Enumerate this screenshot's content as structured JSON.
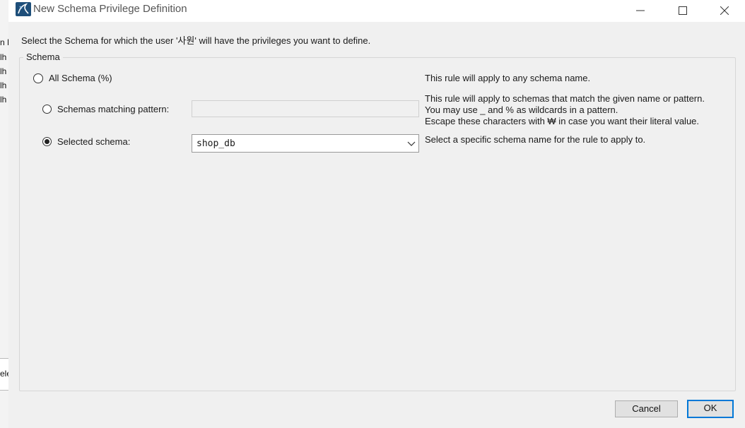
{
  "background_app": {
    "lines": [
      "n H",
      "lh",
      "lh",
      "lh",
      "lh"
    ],
    "bottom_text": "ele"
  },
  "window": {
    "title": "New Schema Privilege Definition"
  },
  "instruction": "Select the Schema for which the user '사원' will have the privileges you want to define.",
  "schema_group": {
    "legend": "Schema",
    "options": [
      {
        "label": "All Schema (%)",
        "checked": false
      },
      {
        "label": "Schemas matching pattern:",
        "checked": false
      },
      {
        "label": "Selected schema:",
        "checked": true
      }
    ],
    "pattern_input": {
      "value": ""
    },
    "selected_schema": {
      "value": "shop_db"
    },
    "descriptions": {
      "all": "This rule will apply to any schema name.",
      "pattern_1": "This rule will apply to schemas that match the given name or pattern.",
      "pattern_2": "You may use _ and % as wildcards in a pattern.",
      "pattern_3": "Escape these characters with ₩ in case you want their literal value.",
      "selected": "Select a specific schema name for the rule to apply to."
    }
  },
  "buttons": {
    "cancel": "Cancel",
    "ok": "OK"
  },
  "icons": {
    "app": "mysql-workbench-icon",
    "minimize": "minimize-icon",
    "maximize": "maximize-icon",
    "close": "close-icon",
    "dropdown": "chevron-down-icon"
  },
  "colors": {
    "accent": "#0078d7",
    "dialog_bg": "#f0f0f0",
    "app_icon_bg": "#1e4f7a"
  }
}
